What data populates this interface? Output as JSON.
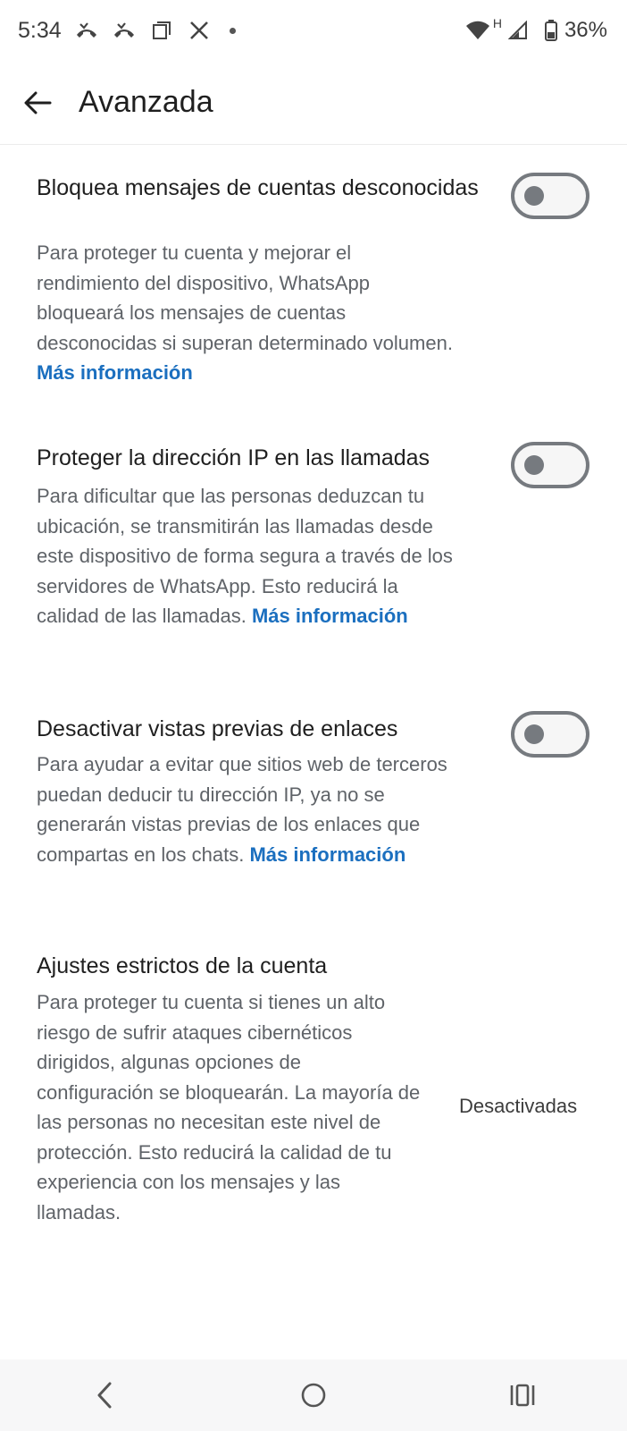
{
  "status_bar": {
    "time": "5:34",
    "network": "H",
    "battery": "36%",
    "icons": [
      "missed-call-icon",
      "missed-call-icon",
      "screenshot-icon",
      "x-app-icon",
      "dot-icon",
      "wifi-icon",
      "signal-icon",
      "battery-icon"
    ]
  },
  "app_bar": {
    "title": "Avanzada",
    "back_icon": "arrow-left-icon"
  },
  "settings": [
    {
      "title": "Bloquea mensajes de cuentas desconocidas",
      "description": "Para proteger tu cuenta y mejorar el rendimiento del dispositivo, WhatsApp bloqueará los mensajes de cuentas desconocidas si superan determinado volumen.",
      "link": "Más información",
      "toggle_on": false
    },
    {
      "title": "Proteger la dirección IP en las llamadas",
      "description": "Para dificultar que las personas deduzcan tu ubicación, se transmitirán las llamadas desde este dispositivo de forma segura a través de los servidores de WhatsApp. Esto reducirá la calidad de las llamadas.",
      "link": "Más información",
      "toggle_on": false
    },
    {
      "title": "Desactivar vistas previas de enlaces",
      "description": "Para ayudar a evitar que sitios web de terceros puedan deducir tu dirección IP, ya no se generarán vistas previas de los enlaces que compartas en los chats.",
      "link": "Más información",
      "toggle_on": false
    },
    {
      "title": "Ajustes estrictos de la cuenta",
      "description": "Para proteger tu cuenta si tienes un alto riesgo de sufrir ataques cibernéticos dirigidos, algunas opciones de configuración se bloquearán. La mayoría de las personas no necesitan este nivel de protección. Esto reducirá la calidad de tu experiencia con los mensajes y las llamadas.",
      "value": "Desactivadas"
    }
  ],
  "nav_bar": {
    "icons": [
      "back-icon",
      "home-icon",
      "recents-icon"
    ]
  },
  "colors": {
    "link": "#1b6fbf",
    "toggle_off": "#767a7f",
    "text_secondary": "#5f6368"
  }
}
